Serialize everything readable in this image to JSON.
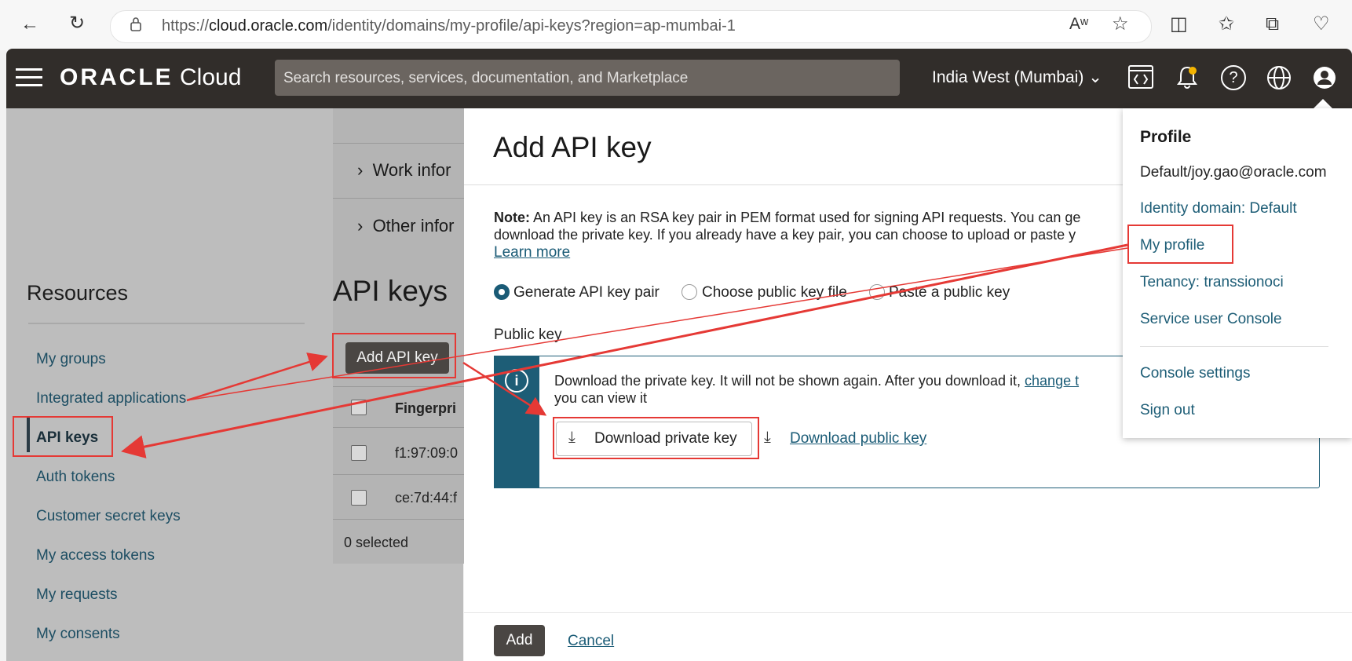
{
  "browser": {
    "url_prefix": "https://",
    "url_host": "cloud.oracle.com",
    "url_path": "/identity/domains/my-profile/api-keys?region=ap-mumbai-1",
    "icons": [
      "back-icon",
      "refresh-icon",
      "lock-icon",
      "read-aloud-icon",
      "star-icon",
      "split-screen-icon",
      "favorites-icon",
      "collections-icon",
      "health-icon"
    ]
  },
  "header": {
    "brand": "ORACLE",
    "product": "Cloud",
    "search_placeholder": "Search resources, services, documentation, and Marketplace",
    "region": "India West (Mumbai)",
    "icons": [
      "code-editor-icon",
      "bell-icon",
      "help-icon",
      "globe-icon",
      "user-icon"
    ]
  },
  "resources": {
    "title": "Resources",
    "items": [
      {
        "label": "My groups"
      },
      {
        "label": "Integrated applications"
      },
      {
        "label": "API keys",
        "active": true
      },
      {
        "label": "Auth tokens"
      },
      {
        "label": "Customer secret keys"
      },
      {
        "label": "My access tokens"
      },
      {
        "label": "My requests"
      },
      {
        "label": "My consents"
      }
    ]
  },
  "profile_sections": {
    "work": "Work infor",
    "other": "Other infor"
  },
  "api_keys": {
    "title": "API keys",
    "add_button": "Add API key",
    "column_fingerprint": "Fingerpri",
    "rows": [
      "f1:97:09:0",
      "ce:7d:44:f"
    ],
    "selected": "0 selected"
  },
  "dialog": {
    "title": "Add API key",
    "note_label": "Note:",
    "note_line1": "An API key is an RSA key pair in PEM format used for signing API requests. You can ge",
    "note_line2": "download the private key. If you already have a key pair, you can choose to upload or paste y",
    "learn_more": "Learn more",
    "radio_generate": "Generate API key pair",
    "radio_choose": "Choose public key file",
    "radio_paste": "Paste a public key",
    "public_key_label": "Public key",
    "info_line1": "Download the private key. It will not be shown again. After you download it,",
    "info_link": "change t",
    "info_line2": "you can view it",
    "download_private": "Download private key",
    "download_public": "Download public key",
    "add": "Add",
    "cancel": "Cancel"
  },
  "profile_menu": {
    "title": "Profile",
    "user": "Default/joy.gao@oracle.com",
    "identity_domain": "Identity domain: Default",
    "my_profile": "My profile",
    "tenancy": "Tenancy: transsionoci",
    "service_console": "Service user Console",
    "console_settings": "Console settings",
    "sign_out": "Sign out"
  },
  "colors": {
    "header_bg": "#312d2a",
    "accent": "#1a5b76",
    "annotation_red": "#e53935"
  }
}
